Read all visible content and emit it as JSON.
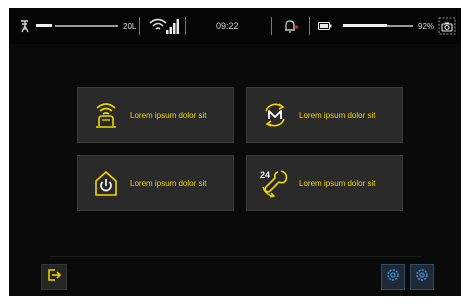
{
  "status_bar": {
    "volume_label": "20L",
    "time": "09:22",
    "battery_label": "92%"
  },
  "icons": {
    "tower": "antenna-wifi-icon",
    "wifi": "wifi-signal-icon",
    "bell": "bell-alert-icon",
    "battery": "battery-icon",
    "camera": "camera-icon",
    "exit": "exit-icon",
    "settings": "gear-icon"
  },
  "tiles": [
    {
      "label": "Lorem ipsum dolor sit",
      "icon": "wireless-charging-icon"
    },
    {
      "label": "Lorem ipsum dolor sit",
      "icon": "maintenance-cycle-icon"
    },
    {
      "label": "Lorem ipsum dolor sit",
      "icon": "home-power-icon"
    },
    {
      "label": "Lorem ipsum dolor sit",
      "icon": "24h-service-icon"
    }
  ],
  "colors": {
    "accent": "#f2d600",
    "alert": "#e0141e",
    "tile_bg": "#2a2a2a",
    "settings_bg": "#1f2a36",
    "settings_icon": "#3f8fd8"
  }
}
